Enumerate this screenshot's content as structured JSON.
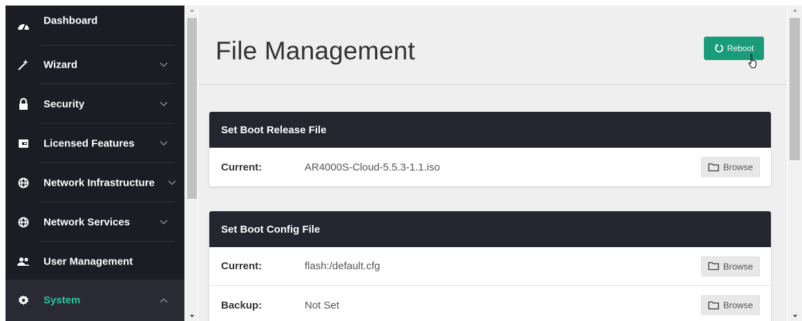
{
  "sidebar": {
    "items": [
      {
        "label": "Dashboard",
        "icon": "dashboard-gauge-icon"
      },
      {
        "label": "Wizard",
        "icon": "magic-wand-icon"
      },
      {
        "label": "Security",
        "icon": "lock-icon"
      },
      {
        "label": "Licensed Features",
        "icon": "license-card-icon"
      },
      {
        "label": "Network Infrastructure",
        "icon": "globe-icon"
      },
      {
        "label": "Network Services",
        "icon": "globe-icon"
      },
      {
        "label": "User Management",
        "icon": "users-icon"
      },
      {
        "label": "System",
        "icon": "gear-icon"
      }
    ],
    "active_item": "System"
  },
  "page": {
    "title": "File Management",
    "reboot_label": "Reboot"
  },
  "cards": {
    "boot_release": {
      "title": "Set Boot Release File",
      "rows": [
        {
          "label": "Current:",
          "value": "AR4000S-Cloud-5.5.3-1.1.iso",
          "button": "Browse"
        }
      ]
    },
    "boot_config": {
      "title": "Set Boot Config File",
      "rows": [
        {
          "label": "Current:",
          "value": "flash:/default.cfg",
          "button": "Browse"
        },
        {
          "label": "Backup:",
          "value": "Not Set",
          "button": "Browse"
        }
      ]
    }
  },
  "colors": {
    "sidebar_bg": "#1c1c24",
    "accent": "#2ec4a0",
    "reboot_button": "#1a9c7a",
    "card_header": "#252530"
  }
}
